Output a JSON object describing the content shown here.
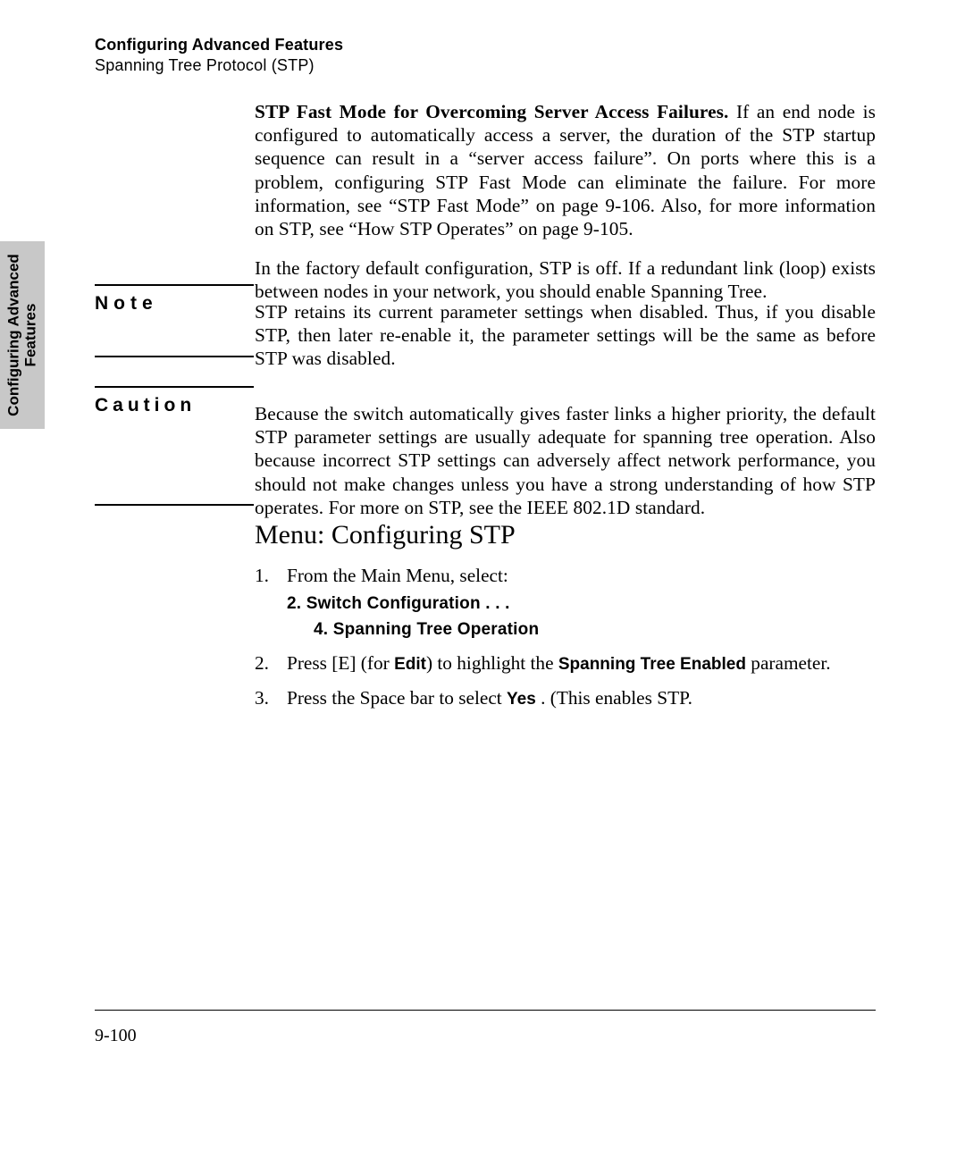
{
  "sideTab": {
    "line1": "Configuring Advanced",
    "line2": "Features"
  },
  "header": {
    "title": "Configuring Advanced Features",
    "subtitle": "Spanning Tree Protocol (STP)"
  },
  "intro": {
    "p1_bold": "STP Fast Mode for Overcoming Server Access Failures.  ",
    "p1_rest": "If an end node is configured to automatically access a server,  the duration of the STP startup sequence can result in a “server access failure”. On ports where this is a problem, configuring STP Fast Mode can eliminate the failure. For more information, see “STP Fast Mode” on page 9-106. Also, for more information on STP, see “How STP Operates” on page 9-105.",
    "p2": "In the factory default configuration, STP is off. If a redundant link (loop) exists between nodes in your network, you should enable Spanning Tree."
  },
  "note": {
    "label": "Note",
    "body": "STP retains its current parameter settings when disabled. Thus, if you disable STP, then later re-enable it, the parameter settings will be the same as before STP was disabled."
  },
  "caution": {
    "label": "Caution",
    "body": "Because the switch automatically gives faster links a higher priority, the default STP parameter settings are usually adequate for spanning tree operation. Also because incorrect STP settings can adversely affect network performance, you should not make changes unless you have a strong under­standing of how STP operates. For more on STP, see the IEEE 802.1D standard."
  },
  "sectionHeading": "Menu: Configuring STP",
  "steps": {
    "s1": {
      "num": "1.",
      "text": "From the Main Menu, select:",
      "sub1": "2. Switch Configuration . . .",
      "sub2": "4. Spanning Tree Operation"
    },
    "s2": {
      "num": "2.",
      "pre": "Press [E] (for ",
      "edit_u": "E",
      "edit_rest": "dit",
      "mid": ")  to highlight the  ",
      "param": "Spanning Tree Enabled",
      "post": " parameter."
    },
    "s3": {
      "num": "3.",
      "pre": "Press the Space bar to select  ",
      "yes": "Yes",
      "post": " . (This enables STP."
    }
  },
  "pageNumber": "9-100"
}
